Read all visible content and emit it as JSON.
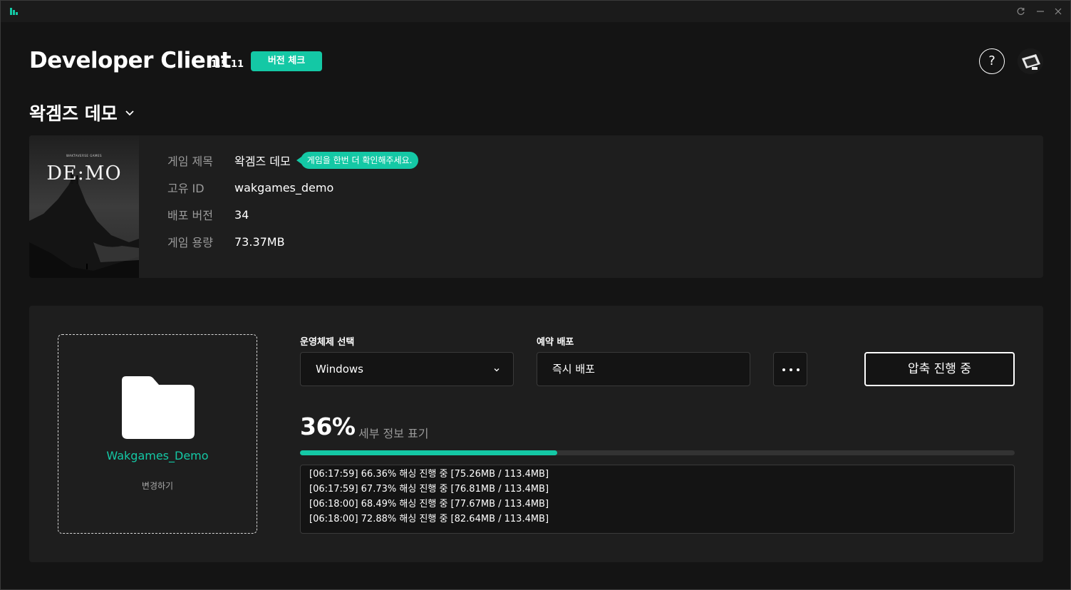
{
  "colors": {
    "accent": "#14c8a5",
    "background": "#141414",
    "card": "#1e1e1e"
  },
  "window": {
    "icons": [
      "refresh-icon",
      "minimize-icon",
      "close-icon"
    ]
  },
  "header": {
    "title": "Developer Client",
    "version": "1.5.11",
    "version_check_label": "버전 체크",
    "help_label": "?"
  },
  "game_selector": {
    "selected": "왁겜즈 데모"
  },
  "game_info": {
    "cover": {
      "studio": "WAKTAVERSE GAMES",
      "title": "DE:MO"
    },
    "rows": [
      {
        "label": "게임 제목",
        "value": "왁겜즈 데모"
      },
      {
        "label": "고유 ID",
        "value": "wakgames_demo"
      },
      {
        "label": "배포 버전",
        "value": "34"
      },
      {
        "label": "게임 용량",
        "value": "73.37MB"
      }
    ],
    "notice": "게임을 한번 더 확인해주세요."
  },
  "deploy": {
    "folder_name": "Wakgames_Demo",
    "change_label": "변경하기",
    "os_label": "운영체제 선택",
    "os_value": "Windows",
    "schedule_label": "예약 배포",
    "schedule_value": "즉시 배포",
    "status_button": "압축 진행 중",
    "progress_percent": 36,
    "progress_text": "36%",
    "detail_toggle": "세부 정보 표기",
    "logs": [
      "[06:17:59] 66.36% 해싱 진행 중 [75.26MB / 113.4MB]",
      "[06:17:59] 67.73% 해싱 진행 중 [76.81MB / 113.4MB]",
      "[06:18:00] 68.49% 해싱 진행 중 [77.67MB / 113.4MB]",
      "[06:18:00] 72.88% 해싱 진행 중 [82.64MB / 113.4MB]"
    ]
  }
}
